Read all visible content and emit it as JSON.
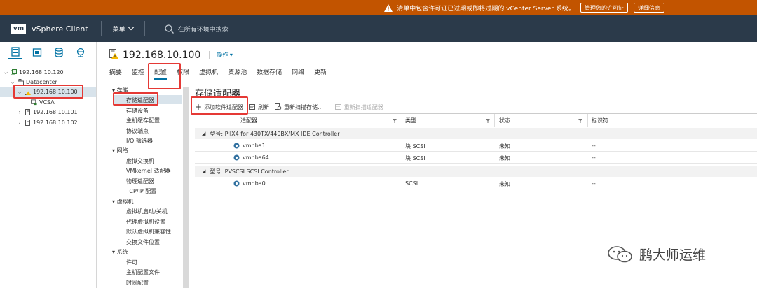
{
  "alert": {
    "message": "清单中包含许可证已过期或即将过期的 vCenter Server 系统。",
    "manage_button": "管理您的许可证",
    "details_button": "详细信息"
  },
  "header": {
    "logo": "vm",
    "title": "vSphere Client",
    "menu_label": "菜单",
    "search_placeholder": "在所有环境中搜索"
  },
  "tree": {
    "items": [
      {
        "label": "192.168.10.120"
      },
      {
        "label": "Datacenter"
      },
      {
        "label": "192.168.10.100"
      },
      {
        "label": "VCSA"
      },
      {
        "label": "192.168.10.101"
      },
      {
        "label": "192.168.10.102"
      }
    ]
  },
  "object": {
    "name": "192.168.10.100",
    "actions_label": "操作 ▾"
  },
  "tabs": [
    {
      "label": "摘要"
    },
    {
      "label": "监控"
    },
    {
      "label": "配置"
    },
    {
      "label": "权限"
    },
    {
      "label": "虚拟机"
    },
    {
      "label": "资源池"
    },
    {
      "label": "数据存储"
    },
    {
      "label": "网络"
    },
    {
      "label": "更新"
    }
  ],
  "config_nav": {
    "sections": [
      {
        "label": "存储",
        "items": [
          "存储适配器",
          "存储设备",
          "主机缓存配置",
          "协议端点",
          "I/O 筛选器"
        ]
      },
      {
        "label": "网络",
        "items": [
          "虚拟交换机",
          "VMkernel 适配器",
          "物理适配器",
          "TCP/IP 配置"
        ]
      },
      {
        "label": "虚拟机",
        "items": [
          "虚拟机启动/关机",
          "代理虚拟机设置",
          "默认虚拟机兼容性",
          "交换文件位置"
        ]
      },
      {
        "label": "系统",
        "items": [
          "许可",
          "主机配置文件",
          "时间配置"
        ]
      }
    ]
  },
  "main": {
    "title": "存储适配器",
    "toolbar": {
      "add": "添加软件适配器",
      "refresh": "刷新",
      "rescan_storage": "重新扫描存储...",
      "rescan_adapter": "重新扫描适配器"
    },
    "columns": [
      "适配器",
      "类型",
      "状态",
      "标识符"
    ],
    "groups": [
      {
        "label": "型号: PIIX4 for 430TX/440BX/MX IDE Controller",
        "rows": [
          {
            "adapter": "vmhba1",
            "type": "块 SCSI",
            "status": "未知",
            "id": "--"
          },
          {
            "adapter": "vmhba64",
            "type": "块 SCSI",
            "status": "未知",
            "id": "--"
          }
        ]
      },
      {
        "label": "型号: PVSCSI SCSI Controller",
        "rows": [
          {
            "adapter": "vmhba0",
            "type": "SCSI",
            "status": "未知",
            "id": "--"
          }
        ]
      }
    ]
  },
  "watermark": "鹏大师运维",
  "colors": {
    "alert_bg": "#c25400",
    "header_bg": "#2b3a4a",
    "accent": "#0072a3",
    "highlight_box": "#e53935"
  }
}
